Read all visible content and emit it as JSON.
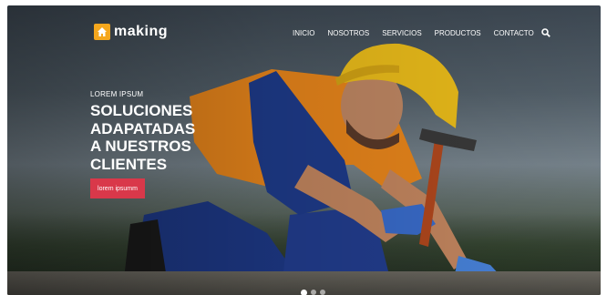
{
  "brand": {
    "name": "making",
    "icon": "home-icon",
    "accent": "#f5a71d"
  },
  "nav": {
    "items": [
      "INICIO",
      "NOSOTROS",
      "SERVICIOS",
      "PRODUCTOS",
      "CONTACTO"
    ],
    "search_icon": "search-icon"
  },
  "hero": {
    "eyebrow": "LOREM IPSUM",
    "headline_lines": [
      "SOLUCIONES",
      "ADAPATADAS",
      "A NUESTROS",
      "CLIENTES"
    ],
    "cta_label": "lorem ipsumm",
    "cta_color": "#d9384a"
  },
  "carousel": {
    "slides": 3,
    "active": 1
  }
}
